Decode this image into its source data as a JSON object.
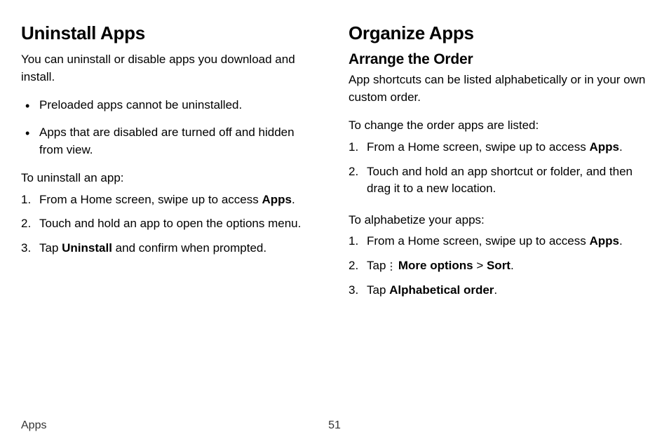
{
  "left": {
    "heading": "Uninstall Apps",
    "intro": "You can uninstall or disable apps you download and install.",
    "bullets": [
      "Preloaded apps cannot be uninstalled.",
      "Apps that are disabled are turned off and hidden from view."
    ],
    "steps_intro": "To uninstall an app:",
    "step1_pre": "From a Home screen, swipe up to access ",
    "step1_b": "Apps",
    "step1_post": ".",
    "step2": "Touch and hold an app to open the options menu.",
    "step3_pre": "Tap ",
    "step3_b": "Uninstall",
    "step3_post": " and confirm when prompted."
  },
  "right": {
    "heading": "Organize Apps",
    "sub": "Arrange the Order",
    "intro": "App shortcuts can be listed alphabetically or in your own custom order.",
    "order_intro": "To change the order apps are listed:",
    "o1_pre": "From a Home screen, swipe up to access ",
    "o1_b": "Apps",
    "o1_post": ".",
    "o2": "Touch and hold an app shortcut or folder, and then drag it to a new location.",
    "alpha_intro": "To alphabetize your apps:",
    "a1_pre": "From a Home screen, swipe up to access ",
    "a1_b": "Apps",
    "a1_post": ".",
    "a2_pre": "Tap ",
    "a2_b1": "More options",
    "a2_sep": " > ",
    "a2_b2": "Sort",
    "a2_post": ".",
    "a3_pre": "Tap ",
    "a3_b": "Alphabetical order",
    "a3_post": "."
  },
  "footer": {
    "section": "Apps",
    "page": "51"
  }
}
